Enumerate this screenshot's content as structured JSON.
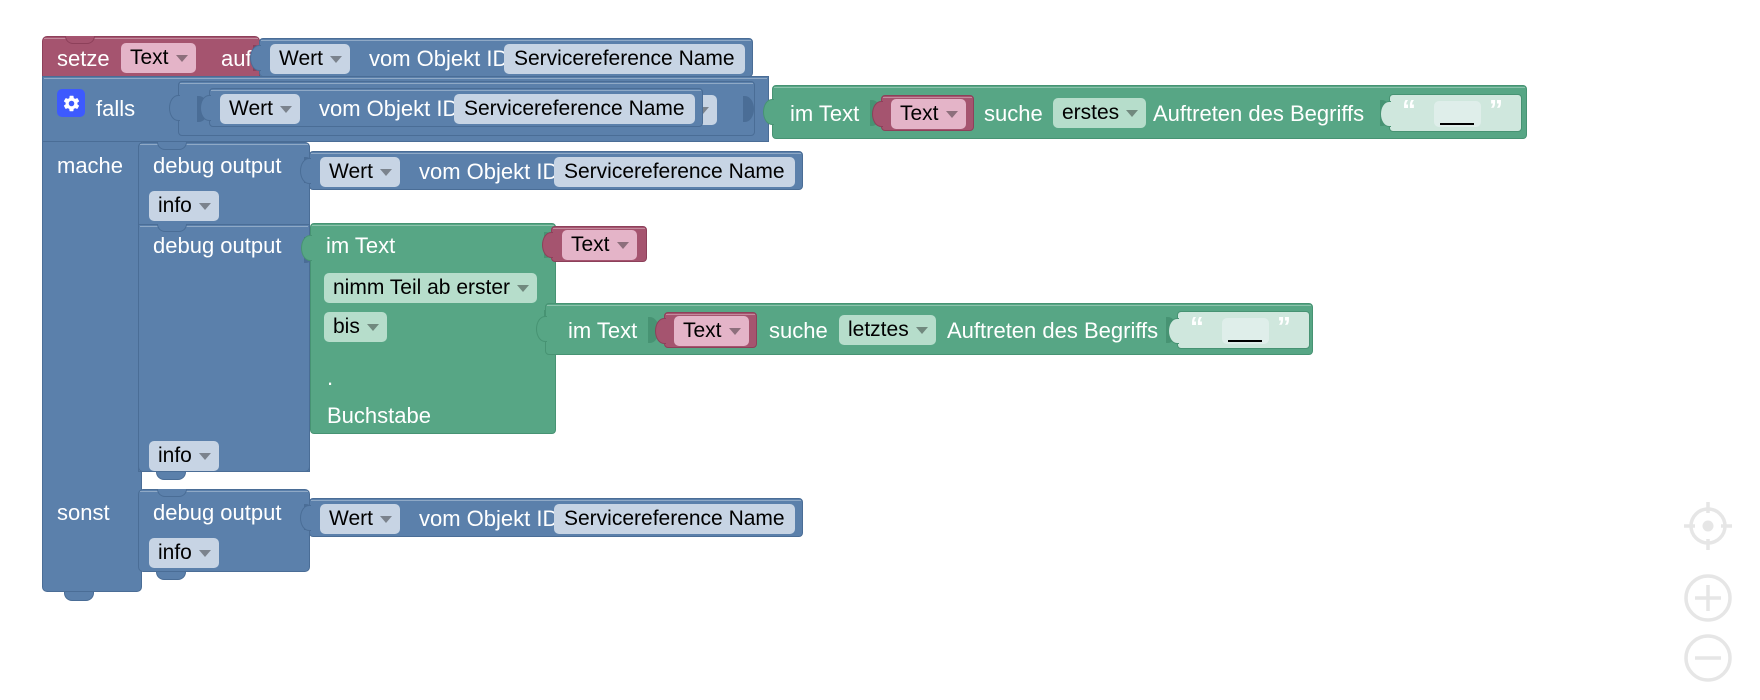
{
  "app": {
    "type": "blockly-workspace",
    "language": "de",
    "background": "#ffffff",
    "grid_color": "#dcdcdc"
  },
  "colors": {
    "variables_block": "#a5546f",
    "variables_field": "#e4b4c8",
    "logic_block": "#5b80ab",
    "logic_field": "#c7d4e4",
    "text_block": "#57a685",
    "text_field": "#b6ddcb",
    "gear_icon": "#3d5afe"
  },
  "blocks": {
    "set_variable": {
      "label_set": "setze",
      "variable": "Text",
      "label_to": "auf",
      "value": {
        "label_value": "Wert",
        "label_of_object_id": "vom Objekt ID",
        "object_id": "Servicereference Name"
      }
    },
    "if_block": {
      "gear_icon": "gear-icon",
      "label_if": "falls",
      "label_do": "mache",
      "label_else": "sonst",
      "condition": {
        "left": {
          "label_value": "Wert",
          "label_of_object_id": "vom Objekt ID",
          "object_id": "Servicereference Name"
        },
        "operator": "=",
        "right": {
          "label_in_text": "im Text",
          "text_variable": "Text",
          "label_find": "suche",
          "occurrence": "erstes",
          "label_occurrence_of": "Auftreten des Begriffs",
          "search_text": ""
        }
      },
      "do_statements": [
        {
          "label": "debug output",
          "severity": "info",
          "value": {
            "label_value": "Wert",
            "label_of_object_id": "vom Objekt ID",
            "object_id": "Servicereference Name"
          }
        },
        {
          "label": "debug output",
          "severity": "info",
          "substring": {
            "label_in_text": "im Text",
            "text_variable": "Text",
            "from_mode": "nimm Teil ab erster",
            "label_to": "bis",
            "to_mode": ".",
            "label_letter": "Buchstabe",
            "to_value": {
              "label_in_text": "im Text",
              "text_variable": "Text",
              "label_find": "suche",
              "occurrence": "letztes",
              "label_occurrence_of": "Auftreten des Begriffs",
              "search_text": ""
            }
          }
        }
      ],
      "else_statements": [
        {
          "label": "debug output",
          "severity": "info",
          "value": {
            "label_value": "Wert",
            "label_of_object_id": "vom Objekt ID",
            "object_id": "Servicereference Name"
          }
        }
      ]
    }
  },
  "zoom_controls": {
    "center": "center-target-icon",
    "zoom_in": "zoom-in-icon",
    "zoom_out": "zoom-out-icon"
  }
}
